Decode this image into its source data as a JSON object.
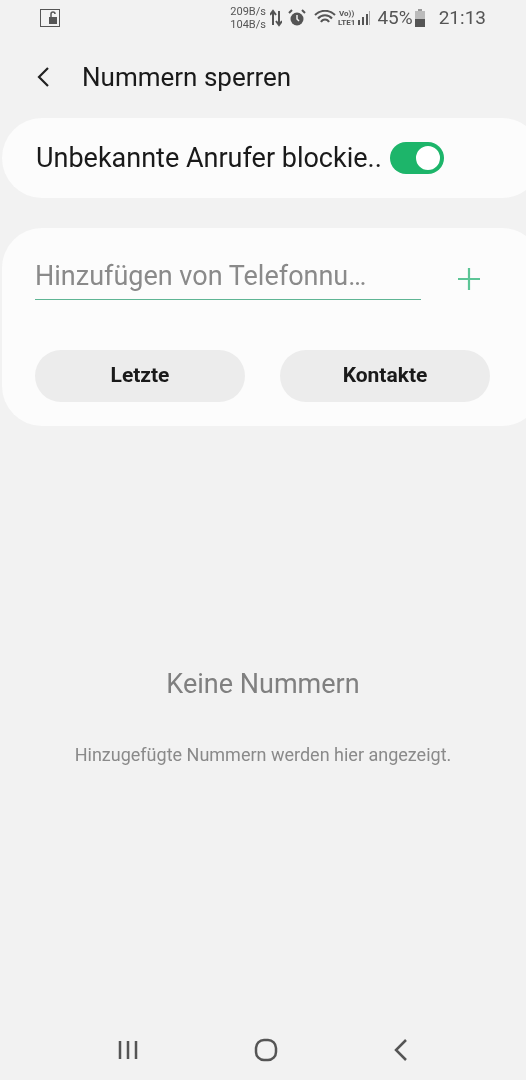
{
  "status_bar": {
    "upload_speed": "209B/s",
    "download_speed": "104B/s",
    "volte_label": "Vo))",
    "network_label": "LTE1",
    "battery": "45%",
    "time": "21:13"
  },
  "header": {
    "title": "Nummern sperren"
  },
  "block_unknown": {
    "label": "Unbekannte Anrufer blockie..",
    "on": true
  },
  "add_number": {
    "placeholder": "Hinzufügen von Telefonnu…",
    "buttons": [
      "Letzte",
      "Kontakte"
    ]
  },
  "empty_state": {
    "title": "Keine Nummern",
    "message": "Hinzugefügte Nummern werden hier angezeigt."
  }
}
